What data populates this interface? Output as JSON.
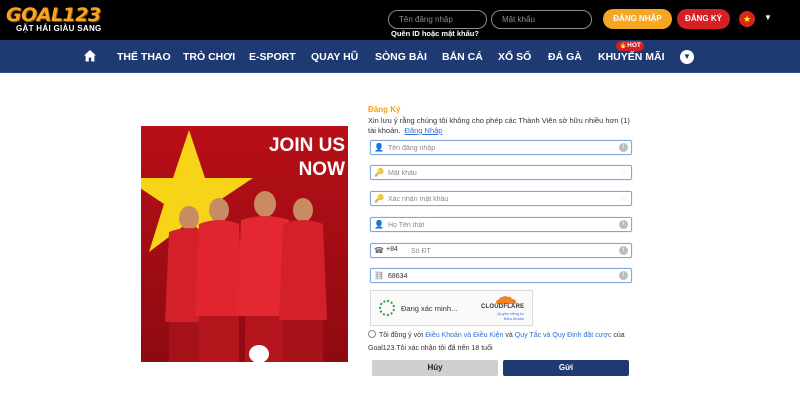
{
  "brand": {
    "logo_text": "GOAL123",
    "tagline": "GẶT HÁI GIÀU SANG"
  },
  "header": {
    "username_placeholder": "Tên đăng nhập",
    "password_placeholder": "Mật khẩu",
    "forgot_label": "Quên ID hoặc mật khẩu?",
    "login_label": "ĐĂNG NHẬP",
    "register_label": "ĐĂNG KÝ",
    "language_flag": "vietnam-flag-icon"
  },
  "nav": {
    "home_icon": "home-icon",
    "items": [
      {
        "label": "THỂ THAO"
      },
      {
        "label": "TRÒ CHƠI"
      },
      {
        "label": "E-SPORT"
      },
      {
        "label": "QUAY HŨ"
      },
      {
        "label": "SÒNG BÀI"
      },
      {
        "label": "BẮN CÁ"
      },
      {
        "label": "XỔ SỐ"
      },
      {
        "label": "ĐÁ GÀ"
      },
      {
        "label": "KHUYẾN MÃI"
      }
    ],
    "hot_badge": "HOT"
  },
  "banner": {
    "line1": "JOIN US",
    "line2": "NOW"
  },
  "form": {
    "title": "Đăng Ký",
    "note": "Xin lưu ý rằng chúng tôi không cho phép các Thành Viên sở hữu nhiều hơn (1) tài khoản.",
    "login_link": "Đăng Nhập",
    "fields": {
      "username": {
        "placeholder": "Tên đăng nhập",
        "icon": "user-icon"
      },
      "password": {
        "placeholder": "Mật khẩu",
        "icon": "key-icon"
      },
      "confirm": {
        "placeholder": "Xác nhận mật khẩu",
        "icon": "key-icon"
      },
      "fullname": {
        "placeholder": "Họ Tên thật",
        "icon": "user-icon"
      },
      "phone": {
        "prefix": "+84",
        "placeholder": "Số ĐT",
        "icon": "phone-icon"
      },
      "captcha_code": {
        "value": "68634",
        "icon": "captcha-icon"
      }
    },
    "captcha": {
      "status": "Đang xác minh...",
      "brand": "CLOUDFLARE",
      "privacy": "Quyền riêng tư",
      "terms": "Điều khoản"
    },
    "agree": {
      "prefix": "Tôi đồng ý với",
      "terms": "Điều Khoản và Điều Kiện",
      "and": "và",
      "rules": "Quy Tắc và Quy Định đặt cược",
      "suffix": "của Goal123.Tôi xác nhận tôi đã trên 18 tuổi"
    },
    "cancel_label": "Hủy",
    "submit_label": "Gửi"
  },
  "colors": {
    "header_bg": "#000000",
    "nav_bg": "#1f3a72",
    "accent_orange": "#f5a623",
    "accent_red": "#d91f26",
    "link_blue": "#2f6fd6"
  }
}
